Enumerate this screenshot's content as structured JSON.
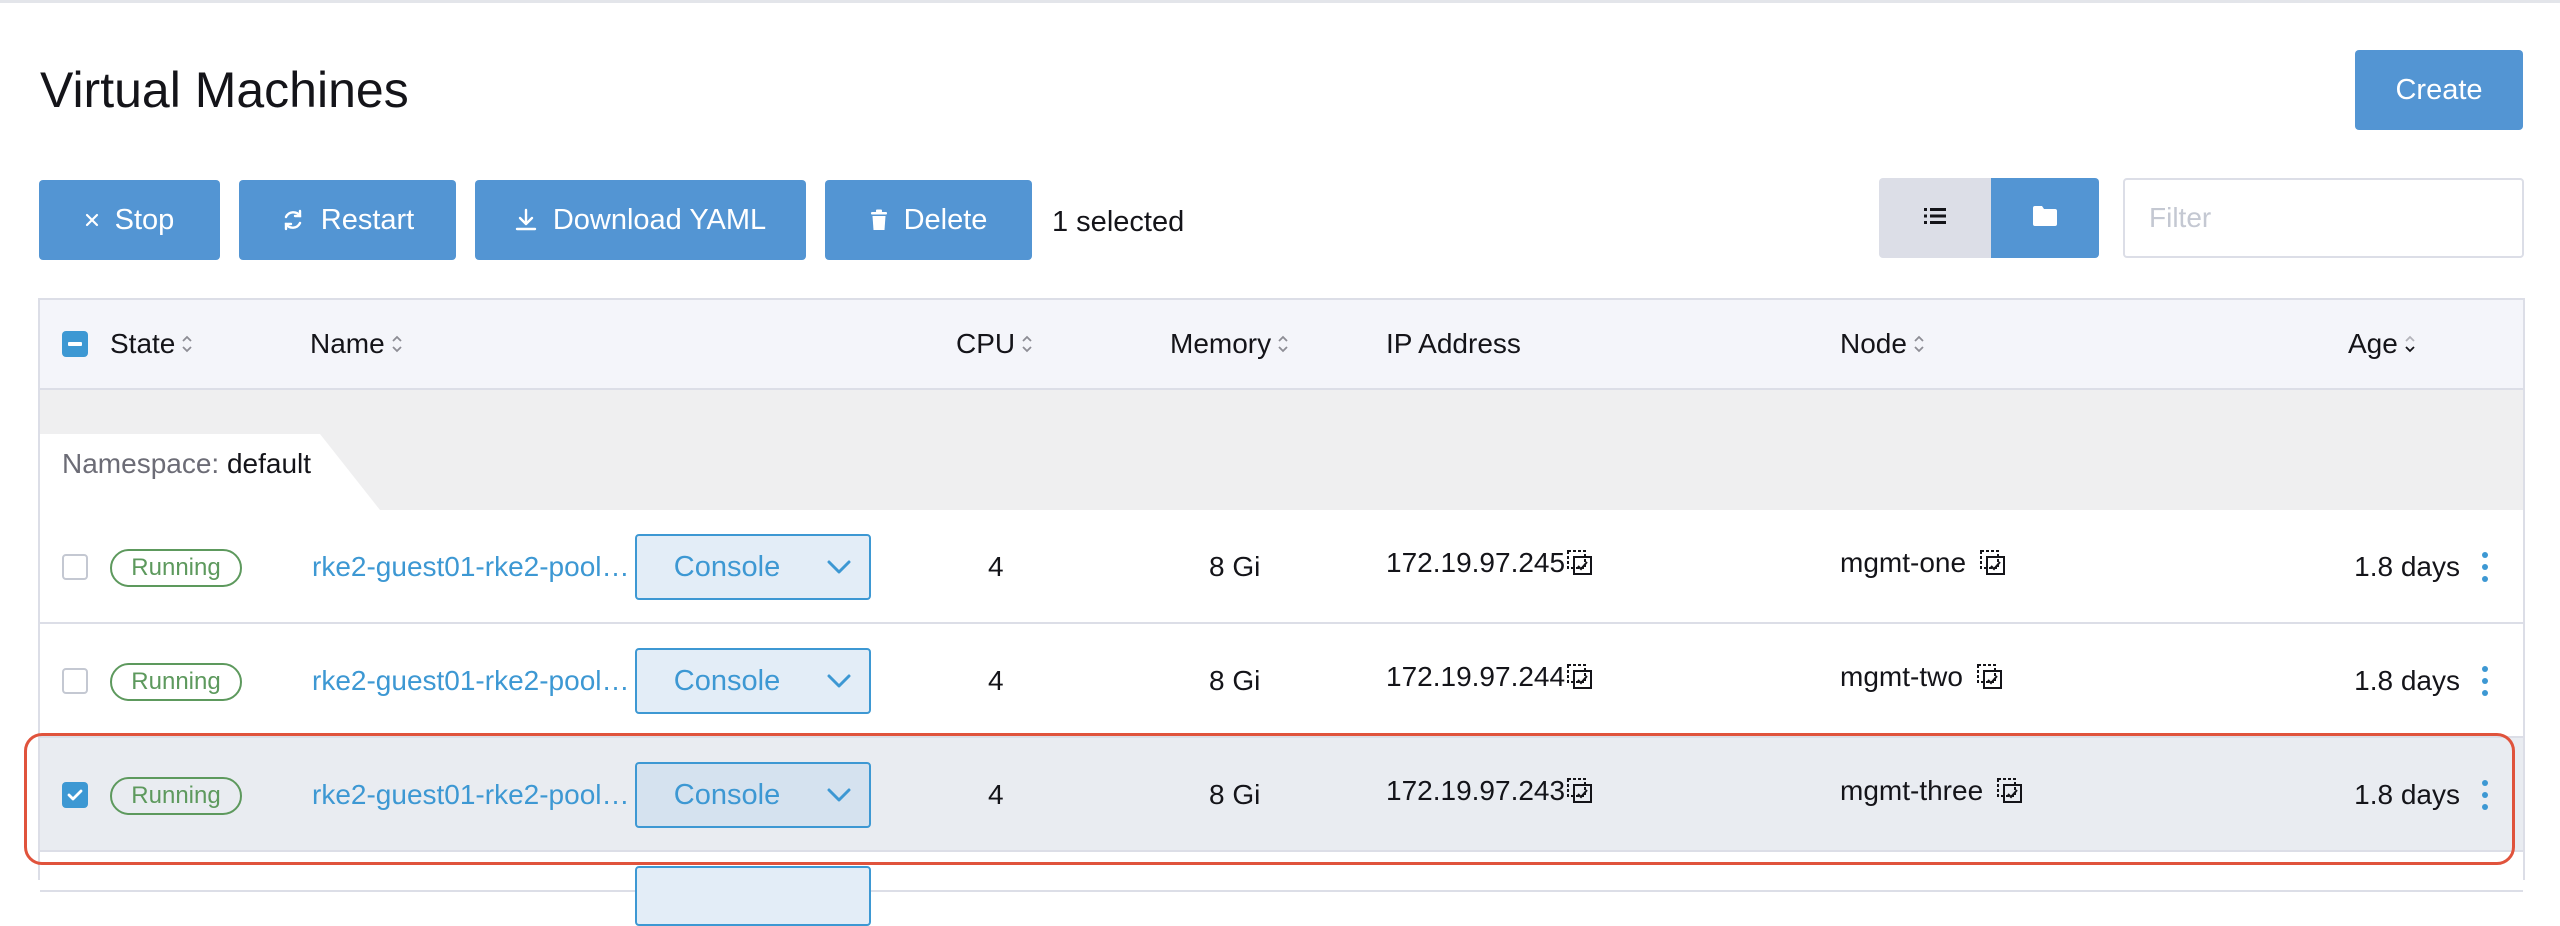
{
  "page": {
    "title": "Virtual Machines",
    "create_label": "Create"
  },
  "toolbar": {
    "stop_label": "Stop",
    "restart_label": "Restart",
    "download_label": "Download YAML",
    "delete_label": "Delete",
    "selected_text": "1 selected",
    "filter_placeholder": "Filter"
  },
  "table": {
    "headers": {
      "state": "State",
      "name": "Name",
      "cpu": "CPU",
      "memory": "Memory",
      "ip": "IP Address",
      "node": "Node",
      "age": "Age"
    },
    "group": {
      "key": "Namespace:",
      "value": "default"
    },
    "rows": [
      {
        "checked": false,
        "state": "Running",
        "name": "rke2-guest01-rke2-pool…",
        "console": "Console",
        "cpu": "4",
        "memory": "8 Gi",
        "ip": "172.19.97.245",
        "node": "mgmt-one",
        "age": "1.8 days"
      },
      {
        "checked": false,
        "state": "Running",
        "name": "rke2-guest01-rke2-pool…",
        "console": "Console",
        "cpu": "4",
        "memory": "8 Gi",
        "ip": "172.19.97.244",
        "node": "mgmt-two",
        "age": "1.8 days"
      },
      {
        "checked": true,
        "state": "Running",
        "name": "rke2-guest01-rke2-pool…",
        "console": "Console",
        "cpu": "4",
        "memory": "8 Gi",
        "ip": "172.19.97.243",
        "node": "mgmt-three",
        "age": "1.8 days"
      }
    ]
  },
  "colors": {
    "primary": "#5395d3",
    "link": "#3d98d3",
    "running": "#5d995d",
    "highlight": "#e0533c"
  }
}
